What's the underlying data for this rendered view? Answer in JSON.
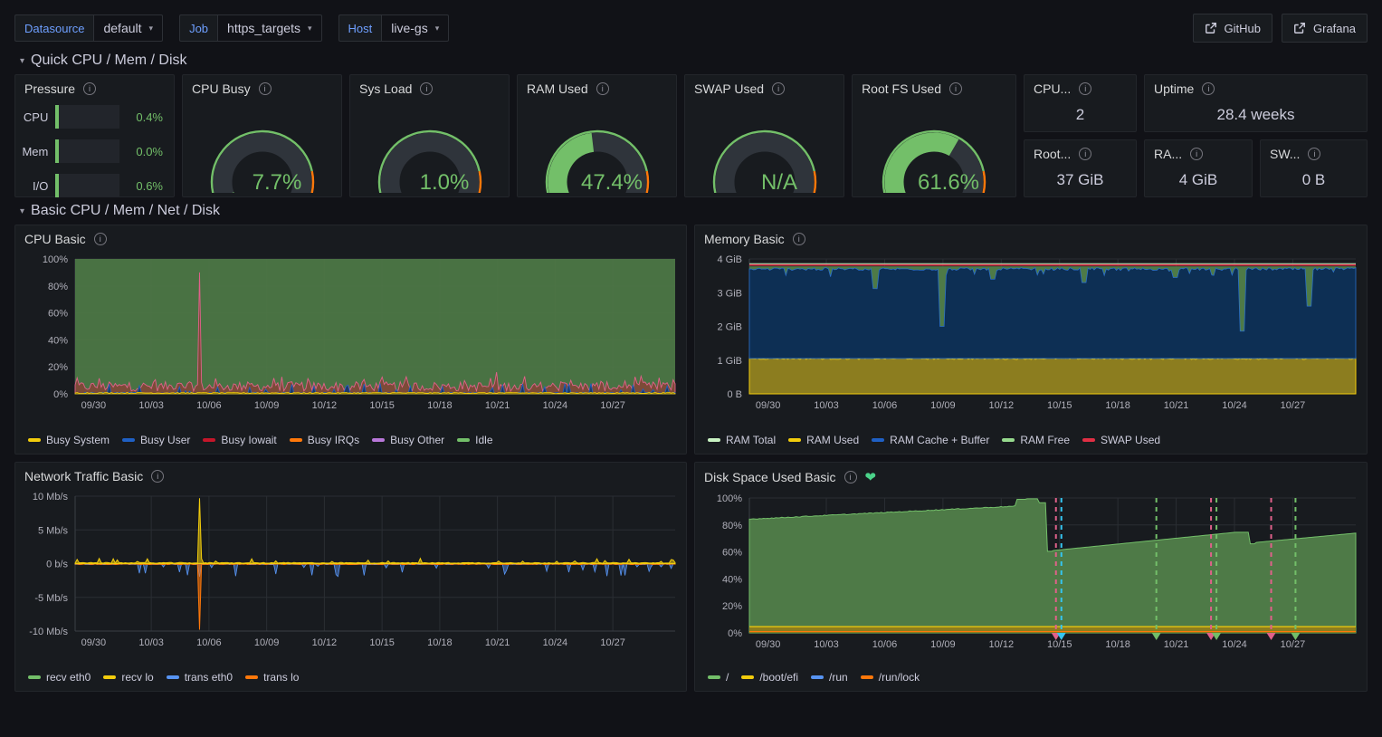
{
  "topbar": {
    "variables": [
      {
        "label": "Datasource",
        "value": "default",
        "name": "datasource"
      },
      {
        "label": "Job",
        "value": "https_targets",
        "name": "job"
      },
      {
        "label": "Host",
        "value": "live-gs",
        "name": "host"
      }
    ],
    "links": [
      {
        "label": "GitHub",
        "icon": "external-link-icon"
      },
      {
        "label": "Grafana",
        "icon": "external-link-icon"
      }
    ]
  },
  "rows": [
    {
      "title": "Quick CPU / Mem / Disk"
    },
    {
      "title": "Basic CPU / Mem / Net / Disk"
    }
  ],
  "pressure": {
    "title": "Pressure",
    "items": [
      {
        "label": "CPU",
        "value": "0.4%",
        "pct": 0.4
      },
      {
        "label": "Mem",
        "value": "0.0%",
        "pct": 0.0
      },
      {
        "label": "I/O",
        "value": "0.6%",
        "pct": 0.6
      }
    ]
  },
  "gauges": [
    {
      "title": "CPU Busy",
      "value": "7.7%",
      "pct": 7.7,
      "name": "cpu-busy"
    },
    {
      "title": "Sys Load",
      "value": "1.0%",
      "pct": 1.0,
      "name": "sys-load"
    },
    {
      "title": "RAM Used",
      "value": "47.4%",
      "pct": 47.4,
      "name": "ram-used"
    },
    {
      "title": "SWAP Used",
      "value": "N/A",
      "pct": null,
      "name": "swap-used"
    },
    {
      "title": "Root FS Used",
      "value": "61.6%",
      "pct": 61.6,
      "name": "root-fs-used"
    }
  ],
  "stats": [
    {
      "title": "CPU...",
      "value": "2",
      "name": "cpu-cores"
    },
    {
      "title": "Uptime",
      "value": "28.4 weeks",
      "name": "uptime"
    },
    {
      "title": "Root...",
      "value": "37 GiB",
      "name": "root-fs-total"
    },
    {
      "title": "RA...",
      "value": "4 GiB",
      "name": "ram-total"
    },
    {
      "title": "SW...",
      "value": "0 B",
      "name": "swap-total"
    }
  ],
  "colors": {
    "green": "#73bf69",
    "yellow": "#f2cc0c",
    "blue": "#5794f2",
    "darkblue": "#1f60c4",
    "red": "#e02f44",
    "darkred": "#c4162a",
    "orange": "#ff780a",
    "purple": "#b877d9",
    "lightgreen": "#96d98d",
    "palegreen": "#c8f2c2",
    "navy": "#0a437c",
    "olive": "#9a8b24"
  },
  "chart_data": [
    {
      "type": "area",
      "name": "cpu-basic",
      "title": "CPU Basic",
      "ylabel": "",
      "xlabel": "",
      "ylim": [
        0,
        100
      ],
      "yticks": [
        "0%",
        "20%",
        "40%",
        "60%",
        "80%",
        "100%"
      ],
      "ytick_values": [
        0,
        20,
        40,
        60,
        80,
        100
      ],
      "xticks": [
        "09/30",
        "10/03",
        "10/06",
        "10/09",
        "10/12",
        "10/15",
        "10/18",
        "10/21",
        "10/24",
        "10/27"
      ],
      "grid": true,
      "legend_position": "bottom",
      "series": [
        {
          "name": "Busy System",
          "color": "#f2cc0c",
          "mean": 0.6
        },
        {
          "name": "Busy User",
          "color": "#1f60c4",
          "mean": 2.5
        },
        {
          "name": "Busy Iowait",
          "color": "#c4162a",
          "mean": 4.0,
          "peak": 90
        },
        {
          "name": "Busy IRQs",
          "color": "#ff780a",
          "mean": 0.1
        },
        {
          "name": "Busy Other",
          "color": "#b877d9",
          "mean": 0.1
        },
        {
          "name": "Idle",
          "color": "#73bf69",
          "mean": 93
        }
      ]
    },
    {
      "type": "area",
      "name": "memory-basic",
      "title": "Memory Basic",
      "ylabel": "",
      "xlabel": "",
      "ylim": [
        0,
        4
      ],
      "yticks": [
        "0 B",
        "1 GiB",
        "2 GiB",
        "3 GiB",
        "4 GiB"
      ],
      "ytick_values": [
        0,
        1,
        2,
        3,
        4
      ],
      "xticks": [
        "09/30",
        "10/03",
        "10/06",
        "10/09",
        "10/12",
        "10/15",
        "10/18",
        "10/21",
        "10/24",
        "10/27"
      ],
      "grid": true,
      "legend_position": "bottom",
      "series": [
        {
          "name": "RAM Total",
          "color": "#c8f2c2",
          "value": 3.82
        },
        {
          "name": "RAM Used",
          "color": "#f2cc0c",
          "value": 1.05
        },
        {
          "name": "RAM Cache + Buffer",
          "color": "#1f60c4",
          "value": 3.72
        },
        {
          "name": "RAM Free",
          "color": "#96d98d",
          "value": 0.1
        },
        {
          "name": "SWAP Used",
          "color": "#e02f44",
          "value": 0
        }
      ]
    },
    {
      "type": "line",
      "name": "network-traffic-basic",
      "title": "Network Traffic Basic",
      "ylabel": "",
      "xlabel": "",
      "ylim": [
        -10,
        10
      ],
      "yticks": [
        "-10 Mb/s",
        "-5 Mb/s",
        "0 b/s",
        "5 Mb/s",
        "10 Mb/s"
      ],
      "ytick_values": [
        -10,
        -5,
        0,
        5,
        10
      ],
      "xticks": [
        "09/30",
        "10/03",
        "10/06",
        "10/09",
        "10/12",
        "10/15",
        "10/18",
        "10/21",
        "10/24",
        "10/27"
      ],
      "grid": true,
      "legend_position": "bottom",
      "series": [
        {
          "name": "recv eth0",
          "color": "#73bf69",
          "mean": 0.05
        },
        {
          "name": "recv lo",
          "color": "#f2cc0c",
          "mean": 0.1,
          "peak": 9.7
        },
        {
          "name": "trans eth0",
          "color": "#5794f2",
          "mean": -0.3
        },
        {
          "name": "trans lo",
          "color": "#ff780a",
          "mean": -0.1,
          "peak": -9.8
        }
      ]
    },
    {
      "type": "area",
      "name": "disk-space-used-basic",
      "title": "Disk Space Used Basic",
      "ylabel": "",
      "xlabel": "",
      "ylim": [
        0,
        100
      ],
      "yticks": [
        "0%",
        "20%",
        "40%",
        "60%",
        "80%",
        "100%"
      ],
      "ytick_values": [
        0,
        20,
        40,
        60,
        80,
        100
      ],
      "xticks": [
        "09/30",
        "10/03",
        "10/06",
        "10/09",
        "10/12",
        "10/15",
        "10/18",
        "10/21",
        "10/24",
        "10/27"
      ],
      "grid": true,
      "legend_position": "bottom",
      "health_badge": "heart-icon",
      "series": [
        {
          "name": "/",
          "color": "#73bf69",
          "start": 84,
          "peak": 99,
          "end": 74
        },
        {
          "name": "/boot/efi",
          "color": "#f2cc0c",
          "value": 4
        },
        {
          "name": "/run",
          "color": "#5794f2",
          "value": 1
        },
        {
          "name": "/run/lock",
          "color": "#ff780a",
          "value": 0.3
        }
      ],
      "annotations": [
        {
          "x_label": "10/15",
          "color": "#e0618a"
        },
        {
          "x_label": "10/15",
          "color": "#35c5f0"
        },
        {
          "x_label": "10/20",
          "color": "#73bf69"
        },
        {
          "x_label": "10/23",
          "color": "#e0618a"
        },
        {
          "x_label": "10/23",
          "color": "#73bf69"
        },
        {
          "x_label": "10/26",
          "color": "#e0618a"
        },
        {
          "x_label": "10/27",
          "color": "#73bf69"
        }
      ]
    }
  ]
}
